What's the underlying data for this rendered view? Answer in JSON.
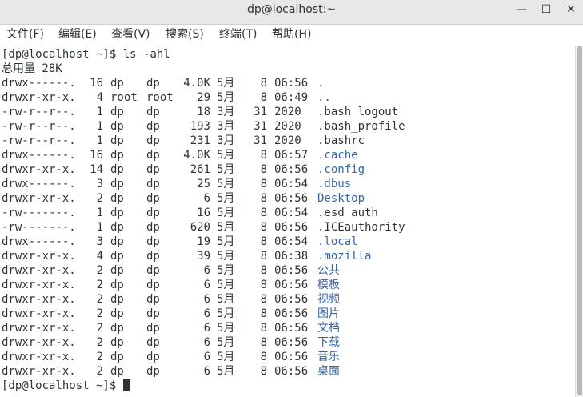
{
  "window": {
    "title": "dp@localhost:~",
    "minimize_glyph": "—",
    "maximize_glyph": "☐",
    "close_glyph": "✕"
  },
  "menu": [
    "文件(F)",
    "编辑(E)",
    "查看(V)",
    "搜索(S)",
    "终端(T)",
    "帮助(H)"
  ],
  "terminal": {
    "prompt": "[dp@localhost ~]$",
    "command": " ls -ahl",
    "total": "总用量 28K",
    "rows": [
      {
        "perm": "drwx------.",
        "links": "16",
        "owner": "dp",
        "group": "dp",
        "size": "4.0K",
        "month": "5月",
        "day": "8",
        "time": "06:56",
        "name": ".",
        "dir": false
      },
      {
        "perm": "drwxr-xr-x.",
        "links": "4",
        "owner": "root",
        "group": "root",
        "size": "29",
        "month": "5月",
        "day": "8",
        "time": "06:49",
        "name": "..",
        "dir": true
      },
      {
        "perm": "-rw-r--r--.",
        "links": "1",
        "owner": "dp",
        "group": "dp",
        "size": "18",
        "month": "3月",
        "day": "31",
        "time": "2020",
        "name": ".bash_logout",
        "dir": false
      },
      {
        "perm": "-rw-r--r--.",
        "links": "1",
        "owner": "dp",
        "group": "dp",
        "size": "193",
        "month": "3月",
        "day": "31",
        "time": "2020",
        "name": ".bash_profile",
        "dir": false
      },
      {
        "perm": "-rw-r--r--.",
        "links": "1",
        "owner": "dp",
        "group": "dp",
        "size": "231",
        "month": "3月",
        "day": "31",
        "time": "2020",
        "name": ".bashrc",
        "dir": false
      },
      {
        "perm": "drwx------.",
        "links": "16",
        "owner": "dp",
        "group": "dp",
        "size": "4.0K",
        "month": "5月",
        "day": "8",
        "time": "06:57",
        "name": ".cache",
        "dir": true
      },
      {
        "perm": "drwxr-xr-x.",
        "links": "14",
        "owner": "dp",
        "group": "dp",
        "size": "261",
        "month": "5月",
        "day": "8",
        "time": "06:56",
        "name": ".config",
        "dir": true
      },
      {
        "perm": "drwx------.",
        "links": "3",
        "owner": "dp",
        "group": "dp",
        "size": "25",
        "month": "5月",
        "day": "8",
        "time": "06:54",
        "name": ".dbus",
        "dir": true
      },
      {
        "perm": "drwxr-xr-x.",
        "links": "2",
        "owner": "dp",
        "group": "dp",
        "size": "6",
        "month": "5月",
        "day": "8",
        "time": "06:56",
        "name": "Desktop",
        "dir": true
      },
      {
        "perm": "-rw-------.",
        "links": "1",
        "owner": "dp",
        "group": "dp",
        "size": "16",
        "month": "5月",
        "day": "8",
        "time": "06:54",
        "name": ".esd_auth",
        "dir": false
      },
      {
        "perm": "-rw-------.",
        "links": "1",
        "owner": "dp",
        "group": "dp",
        "size": "620",
        "month": "5月",
        "day": "8",
        "time": "06:56",
        "name": ".ICEauthority",
        "dir": false
      },
      {
        "perm": "drwx------.",
        "links": "3",
        "owner": "dp",
        "group": "dp",
        "size": "19",
        "month": "5月",
        "day": "8",
        "time": "06:54",
        "name": ".local",
        "dir": true
      },
      {
        "perm": "drwxr-xr-x.",
        "links": "4",
        "owner": "dp",
        "group": "dp",
        "size": "39",
        "month": "5月",
        "day": "8",
        "time": "06:38",
        "name": ".mozilla",
        "dir": true
      },
      {
        "perm": "drwxr-xr-x.",
        "links": "2",
        "owner": "dp",
        "group": "dp",
        "size": "6",
        "month": "5月",
        "day": "8",
        "time": "06:56",
        "name": "公共",
        "dir": true
      },
      {
        "perm": "drwxr-xr-x.",
        "links": "2",
        "owner": "dp",
        "group": "dp",
        "size": "6",
        "month": "5月",
        "day": "8",
        "time": "06:56",
        "name": "模板",
        "dir": true
      },
      {
        "perm": "drwxr-xr-x.",
        "links": "2",
        "owner": "dp",
        "group": "dp",
        "size": "6",
        "month": "5月",
        "day": "8",
        "time": "06:56",
        "name": "视频",
        "dir": true
      },
      {
        "perm": "drwxr-xr-x.",
        "links": "2",
        "owner": "dp",
        "group": "dp",
        "size": "6",
        "month": "5月",
        "day": "8",
        "time": "06:56",
        "name": "图片",
        "dir": true
      },
      {
        "perm": "drwxr-xr-x.",
        "links": "2",
        "owner": "dp",
        "group": "dp",
        "size": "6",
        "month": "5月",
        "day": "8",
        "time": "06:56",
        "name": "文档",
        "dir": true
      },
      {
        "perm": "drwxr-xr-x.",
        "links": "2",
        "owner": "dp",
        "group": "dp",
        "size": "6",
        "month": "5月",
        "day": "8",
        "time": "06:56",
        "name": "下载",
        "dir": true
      },
      {
        "perm": "drwxr-xr-x.",
        "links": "2",
        "owner": "dp",
        "group": "dp",
        "size": "6",
        "month": "5月",
        "day": "8",
        "time": "06:56",
        "name": "音乐",
        "dir": true
      },
      {
        "perm": "drwxr-xr-x.",
        "links": "2",
        "owner": "dp",
        "group": "dp",
        "size": "6",
        "month": "5月",
        "day": "8",
        "time": "06:56",
        "name": "桌面",
        "dir": true
      }
    ],
    "dir_color": "#3465a4",
    "text_color": "#2e3436"
  }
}
